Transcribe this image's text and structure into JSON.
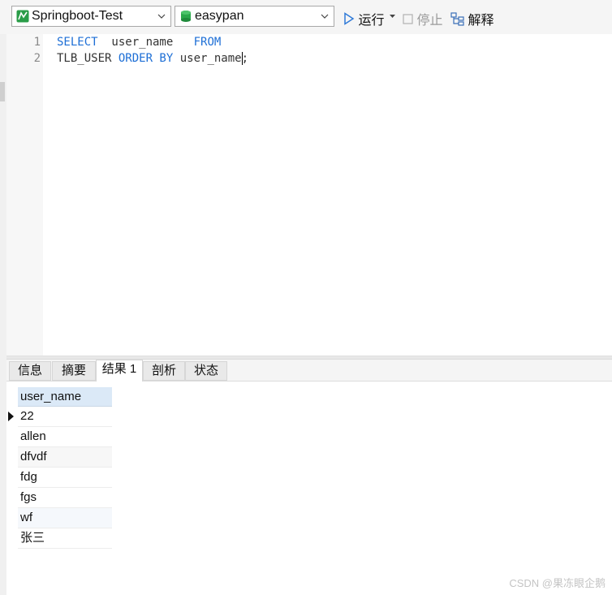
{
  "toolbar": {
    "connection": "Springboot-Test",
    "database": "easypan",
    "run_label": "运行",
    "stop_label": "停止",
    "explain_label": "解释"
  },
  "editor": {
    "lines": [
      {
        "num": "1",
        "parts": [
          "SELECT",
          "  user_name   ",
          "FROM"
        ]
      },
      {
        "num": "2",
        "parts": [
          "TLB_USER ",
          "ORDER BY",
          " user_name",
          ";"
        ]
      }
    ]
  },
  "result_tabs": [
    "信息",
    "摘要",
    "结果 1",
    "剖析",
    "状态"
  ],
  "result_grid": {
    "column": "user_name",
    "rows": [
      "22",
      "allen",
      "dfvdf",
      "fdg",
      "fgs",
      "wf",
      "张三"
    ]
  },
  "watermark": "CSDN @果冻眼企鹅",
  "colors": {
    "keyword": "#1e6fd6",
    "header_bg": "#dbe9f7",
    "run_icon": "#2f7ad8"
  }
}
